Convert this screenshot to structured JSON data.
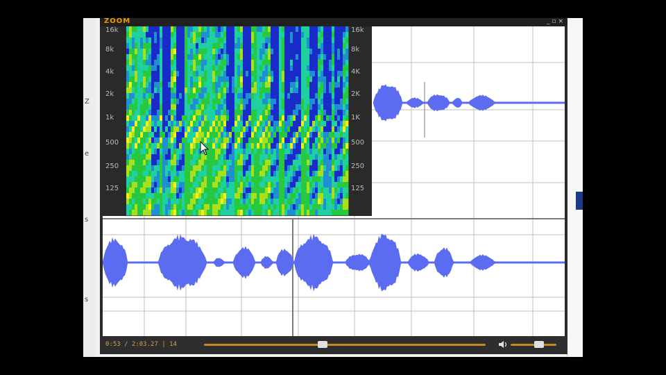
{
  "player": {
    "brand": "ZOOM",
    "window_controls": "_ ▫ ×",
    "time_display": "0:53 / 2:03.27 | 14",
    "seek_progress": 0.42,
    "volume_level": 0.62
  },
  "spectrogram": {
    "freq_labels_left": [
      "16k",
      "8k",
      "4k",
      "2k",
      "1k",
      "500",
      "250",
      "125"
    ],
    "freq_labels_right": [
      "16k",
      "8k",
      "4K",
      "2K",
      "1K",
      "500",
      "250",
      "125"
    ],
    "colormap": [
      "#1a2cc8",
      "#1f8fd0",
      "#1fd0a0",
      "#28c840",
      "#a8e020",
      "#f0f020"
    ]
  },
  "waveform": {
    "color": "#5b6cf0",
    "grid_color": "#bfbfbf"
  },
  "left_strip_marks": [
    "Z",
    "e",
    "s",
    "s"
  ],
  "icons": [
    "speaker-icon",
    "mouse-pointer-icon"
  ]
}
